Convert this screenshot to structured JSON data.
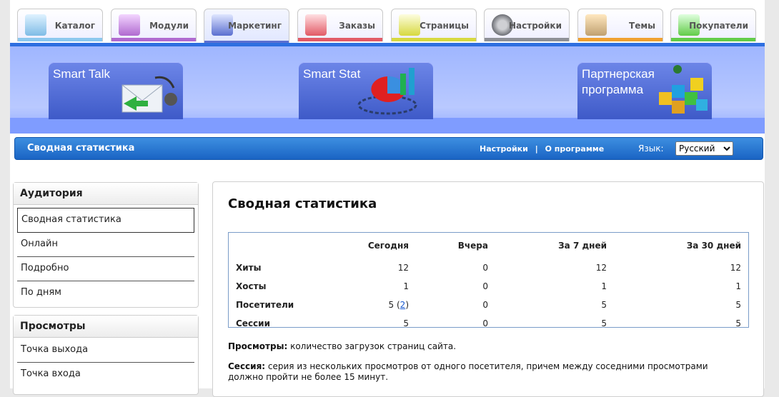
{
  "tabs": [
    {
      "label": "Каталог",
      "icon": "catalog-icon",
      "color": "#8cc8ee"
    },
    {
      "label": "Модули",
      "icon": "modules-icon",
      "color": "#b06ad0"
    },
    {
      "label": "Маркетинг",
      "icon": "marketing-icon",
      "color": "#5b6fd0",
      "active": true
    },
    {
      "label": "Заказы",
      "icon": "orders-icon",
      "color": "#e25a66"
    },
    {
      "label": "Страницы",
      "icon": "pages-icon",
      "color": "#d7d940"
    },
    {
      "label": "Настройки",
      "icon": "settings-icon",
      "color": "#8e9096"
    },
    {
      "label": "Темы",
      "icon": "themes-icon",
      "color": "#f0a030"
    },
    {
      "label": "Покупатели",
      "icon": "customers-icon",
      "color": "#62cc48"
    }
  ],
  "promos": [
    {
      "title": "Smart Talk",
      "icon": "smart-talk-icon"
    },
    {
      "title": "Smart Stat",
      "icon": "smart-stat-icon"
    },
    {
      "title": "Партнерская программа",
      "icon": "partner-program-icon"
    }
  ],
  "header": {
    "title": "Сводная статистика",
    "settings_link": "Настройки",
    "separator": "|",
    "about_link": "О программе",
    "language_label": "Язык:",
    "language_value": "Русский"
  },
  "sidebar": {
    "audience": {
      "title": "Аудитория",
      "items": [
        "Сводная статистика",
        "Онлайн",
        "Подробно",
        "По дням"
      ]
    },
    "views": {
      "title": "Просмотры",
      "items": [
        "Точка выхода",
        "Точка входа"
      ]
    }
  },
  "main": {
    "title": "Сводная статистика",
    "columns": [
      "",
      "Сегодня",
      "Вчера",
      "За 7 дней",
      "За 30 дней"
    ],
    "rows": [
      {
        "label": "Хиты",
        "values": [
          "12",
          "0",
          "12",
          "12"
        ]
      },
      {
        "label": "Хосты",
        "values": [
          "1",
          "0",
          "1",
          "1"
        ]
      },
      {
        "label": "Посетители",
        "today_prefix": "5",
        "today_link": "2",
        "values": [
          "5 (2)",
          "0",
          "5",
          "5"
        ]
      },
      {
        "label": "Сессии",
        "values": [
          "5",
          "0",
          "5",
          "5"
        ]
      }
    ],
    "def_views_term": "Просмотры:",
    "def_views_text": " количество загрузок страниц сайта.",
    "def_session_term": "Сессия:",
    "def_session_text": " серия из нескольких просмотров от одного посетителя, причем между соседними просмотрами должно пройти не более 15 минут."
  }
}
